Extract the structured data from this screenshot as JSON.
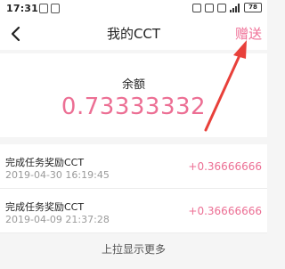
{
  "status_bar": {
    "time": "17:31",
    "battery": "78"
  },
  "nav": {
    "title": "我的CCT",
    "gift_label": "赠送"
  },
  "balance": {
    "label": "余额",
    "value": "0.73333332"
  },
  "transactions": [
    {
      "title": "完成任务奖励CCT",
      "time": "2019-04-30 16:19:45",
      "amount": "+0.36666666"
    },
    {
      "title": "完成任务奖励CCT",
      "time": "2019-04-09 21:37:28",
      "amount": "+0.36666666"
    }
  ],
  "footer": {
    "load_more": "上拉显示更多"
  },
  "colors": {
    "accent": "#ec6f94",
    "annotation_arrow": "#e8403a"
  }
}
